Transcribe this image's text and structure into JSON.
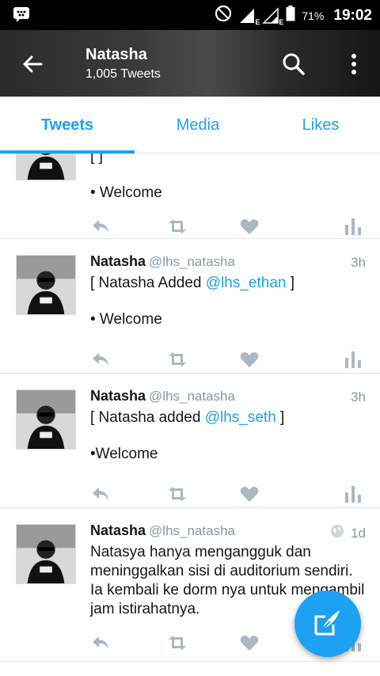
{
  "status_bar": {
    "battery_pct": "71%",
    "time": "19:02",
    "network_letter": "E"
  },
  "header": {
    "title": "Natasha",
    "subtitle": "1,005 Tweets"
  },
  "tabs": [
    {
      "label": "Tweets",
      "active": true
    },
    {
      "label": "Media",
      "active": false
    },
    {
      "label": "Likes",
      "active": false
    }
  ],
  "tweets": [
    {
      "name": "",
      "handle": "",
      "time": "",
      "line1_pre": "[ ",
      "mention": "",
      "line1_post": " ]",
      "line2": "• Welcome"
    },
    {
      "name": "Natasha",
      "handle": "@lhs_natasha",
      "time": "3h",
      "line1_pre": "[ Natasha Added ",
      "mention": "@lhs_ethan",
      "line1_post": " ]",
      "line2": "• Welcome"
    },
    {
      "name": "Natasha",
      "handle": "@lhs_natasha",
      "time": "3h",
      "line1_pre": "[ Natasha added ",
      "mention": "@lhs_seth",
      "line1_post": " ]",
      "line2": "•Welcome"
    },
    {
      "name": "Natasha",
      "handle": "@lhs_natasha",
      "time": "1d",
      "text": "Natasya hanya mengangguk dan meninggalkan sisi di auditorium sendiri. Ia kembali ke dorm nya untuk mengambil jam istirahatnya."
    }
  ],
  "colors": {
    "accent": "#1da1f2",
    "icon_gray": "#aab8c2",
    "text": "#14171a",
    "muted": "#8899a6"
  },
  "icons": [
    "bbm-icon",
    "dnd-icon",
    "signal-icon",
    "battery-icon",
    "back-arrow-icon",
    "search-icon",
    "more-vertical-icon",
    "reply-icon",
    "retweet-icon",
    "like-icon",
    "analytics-icon",
    "globe-icon",
    "compose-icon"
  ]
}
